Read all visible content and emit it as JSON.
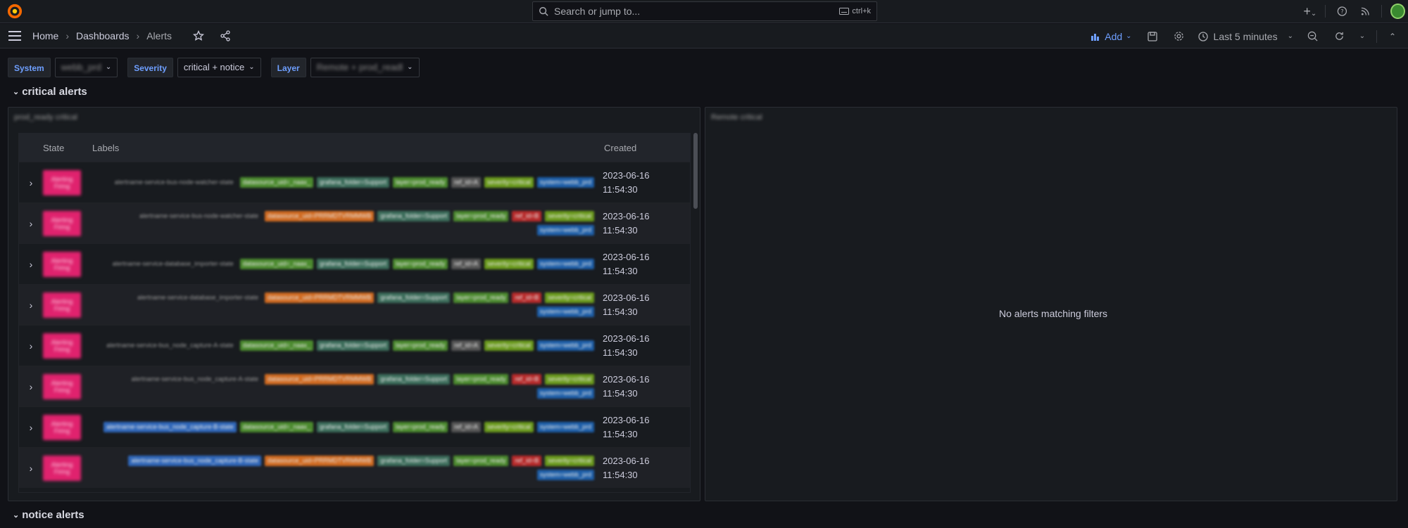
{
  "topbar": {
    "search_placeholder": "Search or jump to...",
    "search_shortcut": "ctrl+k"
  },
  "navbar": {
    "breadcrumbs": [
      "Home",
      "Dashboards",
      "Alerts"
    ],
    "add_label": "Add",
    "time_range": "Last 5 minutes",
    "accent": "#6e9fff"
  },
  "filters": [
    {
      "label": "System",
      "value": "webb_prd"
    },
    {
      "label": "Severity",
      "value": "critical + notice"
    },
    {
      "label": "Layer",
      "value": "Remote + prod_readl"
    }
  ],
  "critical_row": {
    "title": "critical alerts",
    "left_panel_title": "prod_ready critical",
    "right_panel_title": "Remote critical",
    "right_empty": "No alerts matching filters",
    "table": {
      "columns": [
        "State",
        "Labels",
        "Created"
      ],
      "rows": [
        {
          "state": "Alerting Firing",
          "labels": [
            [
              "alertname-service-bus-node-watcher-state",
              "plain"
            ],
            [
              "datasource_uid=_naax_",
              "#4b8a2e"
            ],
            [
              "grafana_folder=Support",
              "#3b6c5a"
            ],
            [
              "layer=prod_ready",
              "#4b8a2e"
            ],
            [
              "ref_id=A",
              "#555"
            ],
            [
              "severity=critical",
              "#6a9a1c"
            ],
            [
              "system=webb_prd",
              "#1d5ea8"
            ]
          ],
          "date": "2023-06-16",
          "time": "11:54:30"
        },
        {
          "state": "Alerting Firing",
          "labels": [
            [
              "alertname-service-bus-node-watcher-state",
              "plain"
            ],
            [
              "datasource_uid=PRRMDTVRMMWB",
              "#d06a20"
            ],
            [
              "grafana_folder=Support",
              "#3b6c5a"
            ],
            [
              "layer=prod_ready",
              "#4b8a2e"
            ],
            [
              "ref_id=B",
              "#b72a2a"
            ],
            [
              "severity=critical",
              "#6a9a1c"
            ],
            [
              "system=webb_prd",
              "#1d5ea8"
            ]
          ],
          "date": "2023-06-16",
          "time": "11:54:30"
        },
        {
          "state": "Alerting Firing",
          "labels": [
            [
              "alertname-service-database_importer-state",
              "plain"
            ],
            [
              "datasource_uid=_naax_",
              "#4b8a2e"
            ],
            [
              "grafana_folder=Support",
              "#3b6c5a"
            ],
            [
              "layer=prod_ready",
              "#4b8a2e"
            ],
            [
              "ref_id=A",
              "#555"
            ],
            [
              "severity=critical",
              "#6a9a1c"
            ],
            [
              "system=webb_prd",
              "#1d5ea8"
            ]
          ],
          "date": "2023-06-16",
          "time": "11:54:30"
        },
        {
          "state": "Alerting Firing",
          "labels": [
            [
              "alertname-service-database_importer-state",
              "plain"
            ],
            [
              "datasource_uid=PRRMDTVRMMWB",
              "#d06a20"
            ],
            [
              "grafana_folder=Support",
              "#3b6c5a"
            ],
            [
              "layer=prod_ready",
              "#4b8a2e"
            ],
            [
              "ref_id=B",
              "#b72a2a"
            ],
            [
              "severity=critical",
              "#6a9a1c"
            ],
            [
              "system=webb_prd",
              "#1d5ea8"
            ]
          ],
          "date": "2023-06-16",
          "time": "11:54:30"
        },
        {
          "state": "Alerting Firing",
          "labels": [
            [
              "alertname-service-bus_node_capture-A-state",
              "plain"
            ],
            [
              "datasource_uid=_naax_",
              "#4b8a2e"
            ],
            [
              "grafana_folder=Support",
              "#3b6c5a"
            ],
            [
              "layer=prod_ready",
              "#4b8a2e"
            ],
            [
              "ref_id=A",
              "#555"
            ],
            [
              "severity=critical",
              "#6a9a1c"
            ],
            [
              "system=webb_prd",
              "#1d5ea8"
            ]
          ],
          "date": "2023-06-16",
          "time": "11:54:30"
        },
        {
          "state": "Alerting Firing",
          "labels": [
            [
              "alertname-service-bus_node_capture-A-state",
              "plain"
            ],
            [
              "datasource_uid=PRRMDTVRMMWB",
              "#d06a20"
            ],
            [
              "grafana_folder=Support",
              "#3b6c5a"
            ],
            [
              "layer=prod_ready",
              "#4b8a2e"
            ],
            [
              "ref_id=B",
              "#b72a2a"
            ],
            [
              "severity=critical",
              "#6a9a1c"
            ],
            [
              "system=webb_prd",
              "#1d5ea8"
            ]
          ],
          "date": "2023-06-16",
          "time": "11:54:30"
        },
        {
          "state": "Alerting Firing",
          "labels": [
            [
              "alertname-service-bus_node_capture-B-state",
              "#2f66b8"
            ],
            [
              "datasource_uid=_naax_",
              "#4b8a2e"
            ],
            [
              "grafana_folder=Support",
              "#3b6c5a"
            ],
            [
              "layer=prod_ready",
              "#4b8a2e"
            ],
            [
              "ref_id=A",
              "#555"
            ],
            [
              "severity=critical",
              "#6a9a1c"
            ],
            [
              "system=webb_prd",
              "#1d5ea8"
            ]
          ],
          "date": "2023-06-16",
          "time": "11:54:30"
        },
        {
          "state": "Alerting Firing",
          "labels": [
            [
              "alertname-service-bus_node_capture-B-state",
              "#2f66b8"
            ],
            [
              "datasource_uid=PRRMDTVRMMWB",
              "#d06a20"
            ],
            [
              "grafana_folder=Support",
              "#3b6c5a"
            ],
            [
              "layer=prod_ready",
              "#4b8a2e"
            ],
            [
              "ref_id=B",
              "#b72a2a"
            ],
            [
              "severity=critical",
              "#6a9a1c"
            ],
            [
              "system=webb_prd",
              "#1d5ea8"
            ]
          ],
          "date": "2023-06-16",
          "time": "11:54:30"
        }
      ]
    }
  },
  "notice_row": {
    "title": "notice alerts"
  }
}
